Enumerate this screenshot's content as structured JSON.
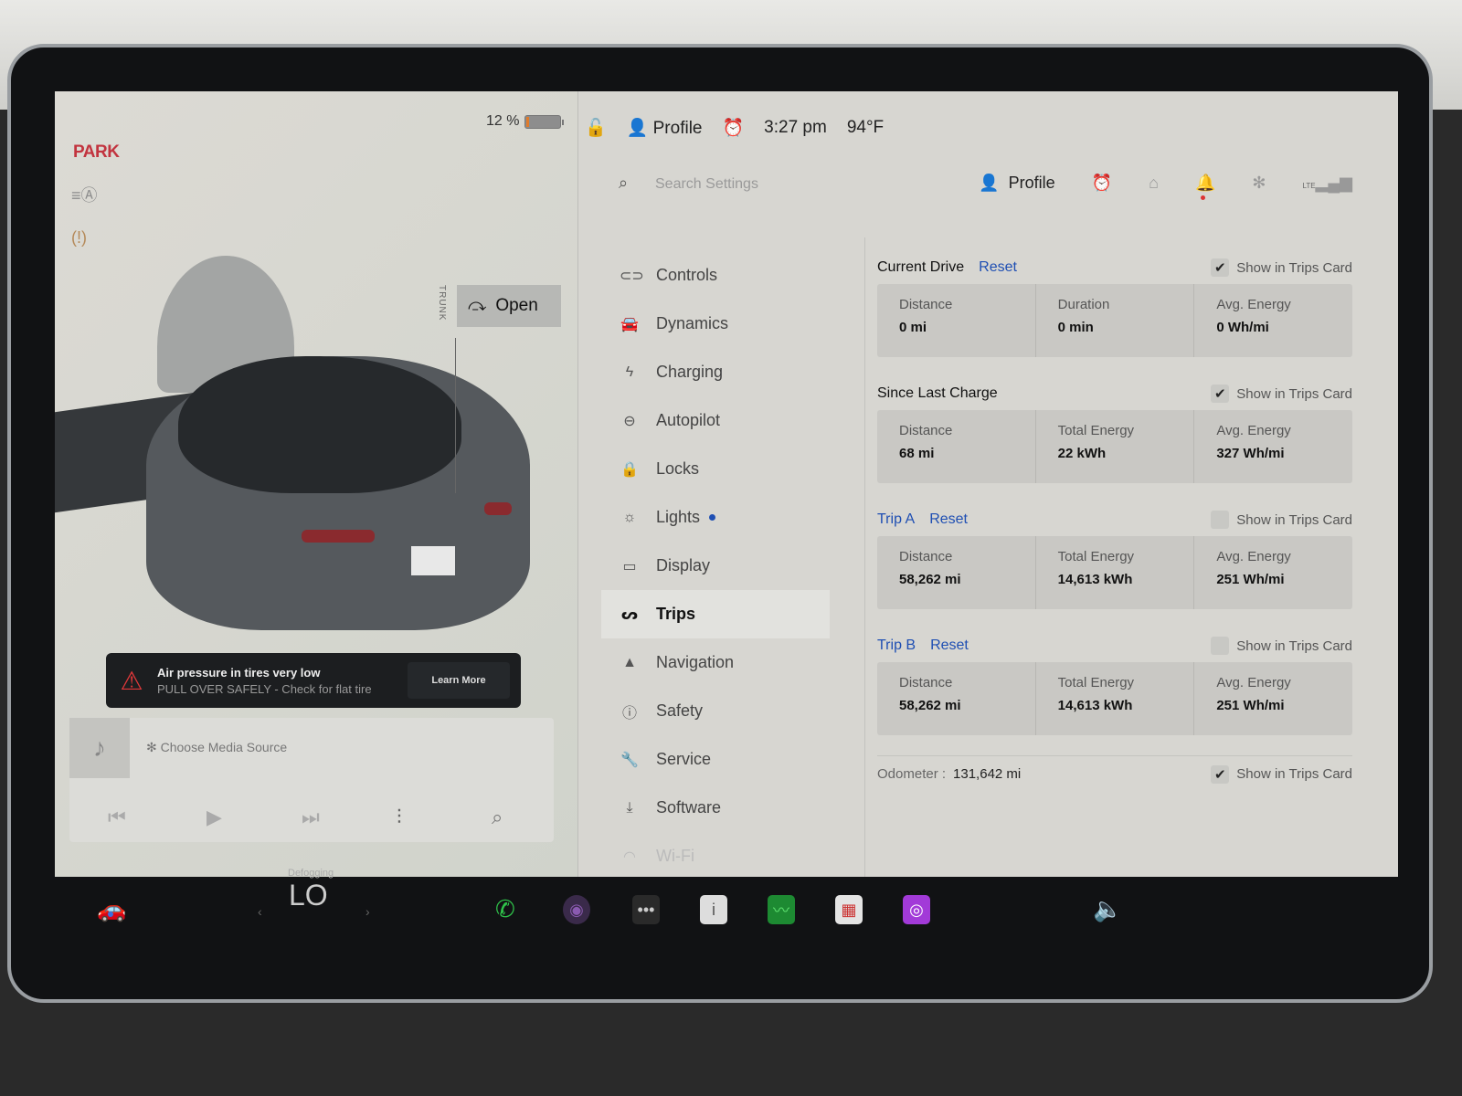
{
  "status": {
    "gear": "PARK",
    "battery_percent_label": "12 %",
    "battery_level": 0.12,
    "profile": "Profile",
    "time": "3:27 pm",
    "temperature": "94°F"
  },
  "car_view": {
    "trunk_label": "TRUNK",
    "trunk_button": "Open"
  },
  "alert": {
    "title": "Air pressure in tires very low",
    "subtitle": "PULL OVER SAFELY - Check for flat tire",
    "action": "Learn More"
  },
  "media": {
    "source_label": "Choose Media Source"
  },
  "settings_header": {
    "search_placeholder": "Search Settings",
    "profile": "Profile",
    "lte": "LTE"
  },
  "nav": {
    "items": [
      {
        "label": "Controls",
        "icon": "toggle-icon"
      },
      {
        "label": "Dynamics",
        "icon": "car-icon"
      },
      {
        "label": "Charging",
        "icon": "bolt-icon"
      },
      {
        "label": "Autopilot",
        "icon": "steering-wheel-icon"
      },
      {
        "label": "Locks",
        "icon": "lock-icon"
      },
      {
        "label": "Lights",
        "icon": "sun-icon"
      },
      {
        "label": "Display",
        "icon": "display-icon"
      },
      {
        "label": "Trips",
        "icon": "trips-icon"
      },
      {
        "label": "Navigation",
        "icon": "navigation-arrow-icon"
      },
      {
        "label": "Safety",
        "icon": "alert-circle-icon"
      },
      {
        "label": "Service",
        "icon": "wrench-icon"
      },
      {
        "label": "Software",
        "icon": "download-icon"
      },
      {
        "label": "Wi-Fi",
        "icon": "wifi-icon"
      }
    ],
    "active": "Trips"
  },
  "trips": {
    "show_label": "Show in Trips Card",
    "reset_label": "Reset",
    "current_drive": {
      "title": "Current Drive",
      "show_checked": true,
      "stats": [
        {
          "label": "Distance",
          "value": "0 mi"
        },
        {
          "label": "Duration",
          "value": "0 min"
        },
        {
          "label": "Avg. Energy",
          "value": "0 Wh/mi"
        }
      ]
    },
    "since_last_charge": {
      "title": "Since Last Charge",
      "show_checked": true,
      "stats": [
        {
          "label": "Distance",
          "value": "68 mi"
        },
        {
          "label": "Total Energy",
          "value": "22 kWh"
        },
        {
          "label": "Avg. Energy",
          "value": "327 Wh/mi"
        }
      ]
    },
    "trip_a": {
      "title": "Trip A",
      "show_checked": false,
      "stats": [
        {
          "label": "Distance",
          "value": "58,262 mi"
        },
        {
          "label": "Total Energy",
          "value": "14,613 kWh"
        },
        {
          "label": "Avg. Energy",
          "value": "251 Wh/mi"
        }
      ]
    },
    "trip_b": {
      "title": "Trip B",
      "show_checked": false,
      "stats": [
        {
          "label": "Distance",
          "value": "58,262 mi"
        },
        {
          "label": "Total Energy",
          "value": "14,613 kWh"
        },
        {
          "label": "Avg. Energy",
          "value": "251 Wh/mi"
        }
      ]
    },
    "odometer": {
      "label": "Odometer :",
      "value": "131,642 mi",
      "show_checked": true
    }
  },
  "dock": {
    "climate_label": "Defogging",
    "climate_temp": "LO"
  },
  "colors": {
    "accent_blue": "#1f4fb3",
    "park_red": "#c2343f",
    "alert_red": "#e0383a",
    "alarm_orange": "#e08a3a"
  }
}
